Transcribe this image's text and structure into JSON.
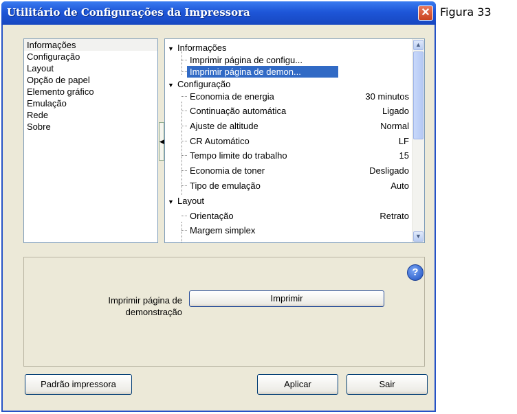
{
  "figure_label": "Figura 33",
  "window": {
    "title": "Utilitário de Configurações da Impressora",
    "close_glyph": "✕"
  },
  "left_nav": {
    "items": [
      "Informações",
      "Configuração",
      "Layout",
      "Opção de papel",
      "Elemento gráfico",
      "Emulação",
      "Rede",
      "Sobre"
    ],
    "selected": "Informações"
  },
  "tree": {
    "informacoes": {
      "label": "Informações",
      "items": [
        "Imprimir página de configu...",
        "Imprimir página de demon..."
      ],
      "selected": "Imprimir página de demon..."
    },
    "configuracao": {
      "label": "Configuração",
      "items": [
        {
          "label": "Economia de energia",
          "value": "30 minutos"
        },
        {
          "label": "Continuação automática",
          "value": "Ligado"
        },
        {
          "label": "Ajuste de altitude",
          "value": "Normal"
        },
        {
          "label": "CR Automático",
          "value": "LF"
        },
        {
          "label": "Tempo limite do trabalho",
          "value": "15"
        },
        {
          "label": "Economia de toner",
          "value": "Desligado"
        },
        {
          "label": "Tipo de emulação",
          "value": "Auto"
        }
      ]
    },
    "layout": {
      "label": "Layout",
      "items": [
        {
          "label": "Orientação",
          "value": "Retrato"
        },
        {
          "label": "Margem simplex",
          "value": ""
        }
      ]
    },
    "expand_glyph": "▼",
    "scroll_up_glyph": "▲",
    "scroll_down_glyph": "▼",
    "splitter_glyph": "◀"
  },
  "detail": {
    "label": "Imprimir página de demonstração",
    "print_button": "Imprimir",
    "help_glyph": "?"
  },
  "footer": {
    "default_button": "Padrão impressora",
    "apply_button": "Aplicar",
    "exit_button": "Sair"
  }
}
